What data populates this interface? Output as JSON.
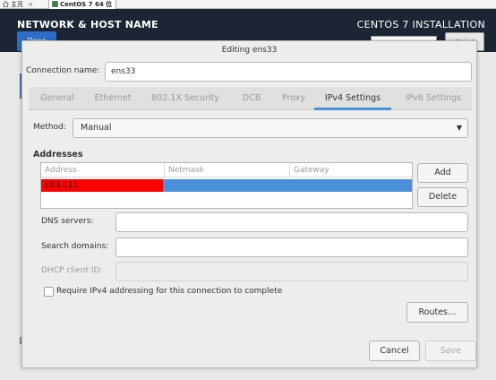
{
  "vm_tabs": [
    {
      "label": "主页",
      "icon": "home-icon"
    },
    {
      "label": "CentOS 7 64 位",
      "icon": "vm-icon"
    }
  ],
  "installer": {
    "title": "NETWORK & HOST NAME",
    "product": "CENTOS 7 INSTALLATION",
    "done_label": "Done",
    "help_label": "Help!"
  },
  "dialog": {
    "title": "Editing ens33",
    "connection_name_label": "Connection name:",
    "connection_name_value": "ens33",
    "tabs": [
      {
        "label": "General",
        "active": false
      },
      {
        "label": "Ethernet",
        "active": false
      },
      {
        "label": "802.1X Security",
        "active": false
      },
      {
        "label": "DCB",
        "active": false
      },
      {
        "label": "Proxy",
        "active": false
      },
      {
        "label": "IPv4 Settings",
        "active": true
      },
      {
        "label": "IPv6 Settings",
        "active": false
      }
    ],
    "method_label": "Method:",
    "method_value": "Manual",
    "addresses_heading": "Addresses",
    "addresses_columns": [
      "Address",
      "Netmask",
      "Gateway"
    ],
    "addresses_rows": [
      {
        "address": "10.1.111.",
        "netmask": "",
        "gateway": ""
      }
    ],
    "add_label": "Add",
    "delete_label": "Delete",
    "dns_label": "DNS servers:",
    "dns_value": "",
    "search_label": "Search domains:",
    "search_value": "",
    "dhcp_label": "DHCP client ID:",
    "dhcp_value": "",
    "require_label": "Require IPv4 addressing for this connection to complete",
    "require_checked": false,
    "routes_label": "Routes…",
    "cancel_label": "Cancel",
    "save_label": "Save"
  },
  "colors": {
    "header_bg": "#1c2533",
    "accent": "#4a90d9",
    "done_button": "#2c6ec8",
    "redaction": "#ff0000"
  }
}
